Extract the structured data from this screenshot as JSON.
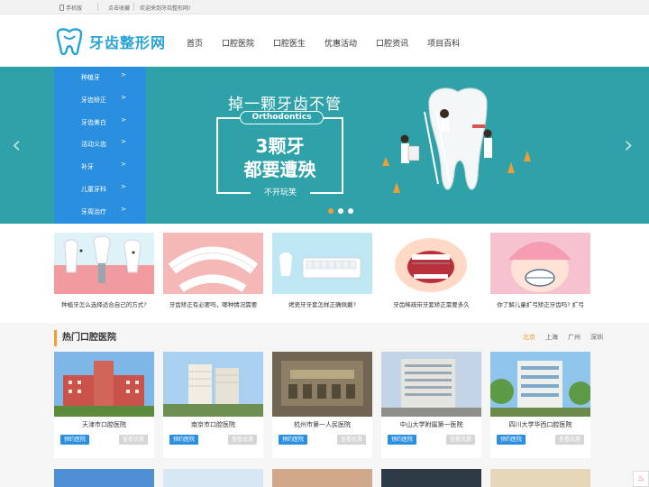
{
  "topbar": {
    "mobile": "手机版",
    "favorite": "点击收藏",
    "welcome": "欢迎来到牙齿整形网!"
  },
  "logo": {
    "text": "牙齿整形网"
  },
  "nav": [
    "首页",
    "口腔医院",
    "口腔医生",
    "优惠活动",
    "口腔资讯",
    "项目百科"
  ],
  "side_menu": [
    "种植牙",
    "牙齿矫正",
    "牙齿美白",
    "活动义齿",
    "补牙",
    "儿童牙科",
    "牙周治疗"
  ],
  "banner": {
    "title": "掉一颗牙齿不管",
    "tag": "Orthodontics",
    "line1": "3颗牙",
    "line2": "都要遭殃",
    "bottom": "不开玩笑"
  },
  "strip": [
    "种植牙怎么选择适合自己的方式?",
    "牙齿矫正有必要吗，哪种情况需要",
    "烤瓷牙牙套怎样正确佩戴?",
    "牙齿稀疏带牙套矫正需要多久",
    "你了解儿童扩弓矫正牙齿吗? 扩弓"
  ],
  "section": {
    "title": "热门口腔医院",
    "cities": [
      "北京",
      "上海",
      "广州",
      "深圳"
    ]
  },
  "hospitals": [
    "天津市口腔医院",
    "南京市口腔医院",
    "杭州市第一人民医院",
    "中山大学附属第一医院",
    "四川大学华西口腔医院"
  ],
  "buttons": {
    "appoint": "预约医院",
    "deals": "查看优惠"
  },
  "colors": {
    "brand": "#27a3d6",
    "banner": "#2fa1a8",
    "menu": "#2b8fe0",
    "accent": "#f39c33"
  }
}
